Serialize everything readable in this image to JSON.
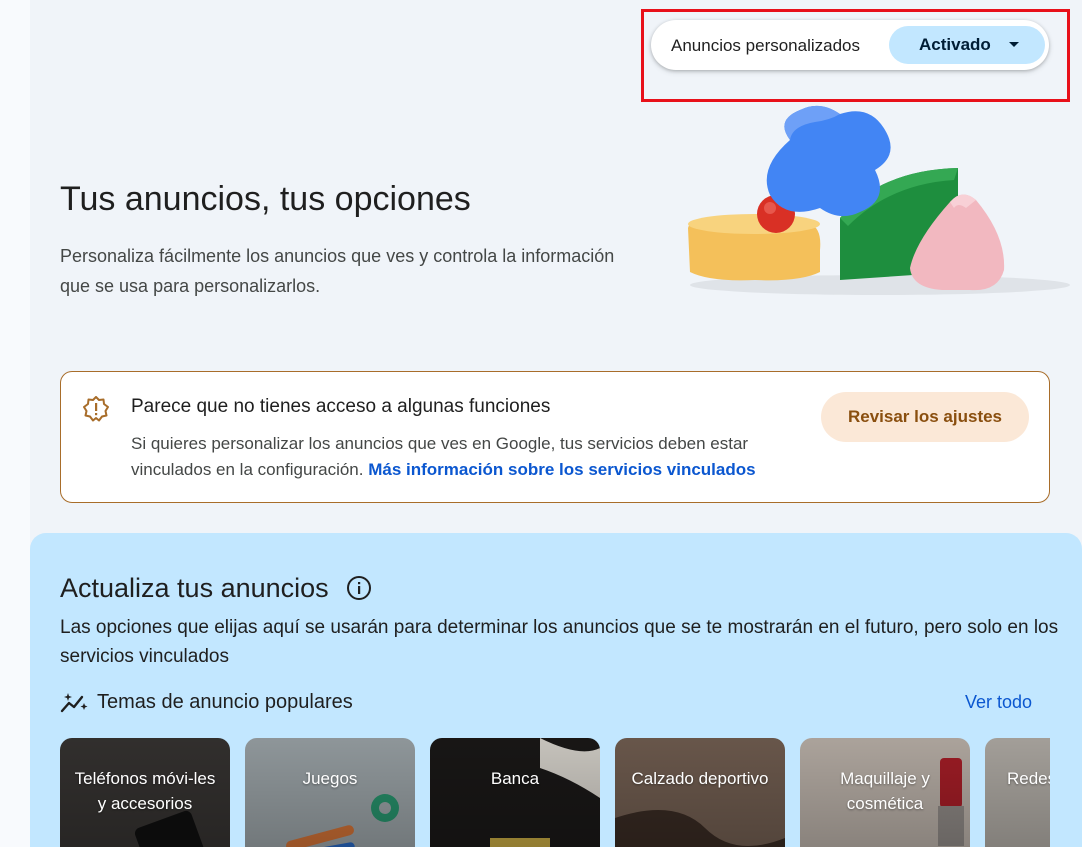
{
  "toggle": {
    "label": "Anuncios personalizados",
    "value": "Activado"
  },
  "hero": {
    "title": "Tus anuncios, tus opciones",
    "description": "Personaliza fácilmente los anuncios que ves y controla la información que se usa para personalizarlos."
  },
  "notice": {
    "title": "Parece que no tienes acceso a algunas funciones",
    "body": "Si quieres personalizar los anuncios que ves en Google, tus servicios deben estar vinculados en la configuración.",
    "link": "Más información sobre los servicios vinculados",
    "button": "Revisar los ajustes"
  },
  "update": {
    "title": "Actualiza tus anuncios",
    "description": "Las opciones que elijas aquí se usarán para determinar los anuncios que se te mostrarán en el futuro, pero solo en los servicios vinculados",
    "popular_title": "Temas de anuncio populares",
    "view_all": "Ver todo",
    "topics": [
      {
        "label": "Teléfonos móvi-les y accesorios",
        "bg": "#3a3735"
      },
      {
        "label": "Juegos",
        "bg": "#9aa3a8"
      },
      {
        "label": "Banca",
        "bg": "#1c1a19"
      },
      {
        "label": "Calzado deportivo",
        "bg": "#5a4a42"
      },
      {
        "label": "Maquillaje y cosmética",
        "bg": "#b7aba2"
      },
      {
        "label": "Redes y com...",
        "bg": "#c9c4bd"
      }
    ]
  },
  "colors": {
    "accent": "#0b57d0",
    "toggle_bg": "#c2e7ff",
    "highlight": "#e8101a",
    "notice_border": "#a86d2a"
  }
}
